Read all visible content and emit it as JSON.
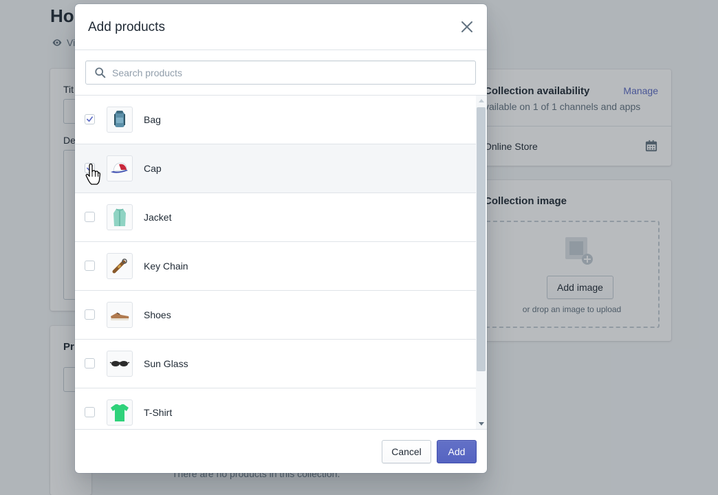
{
  "background": {
    "page_title": "Ho",
    "view_link": "Vi",
    "title_label": "Tit",
    "description_label": "De",
    "products_heading": "Pr",
    "empty_text": "There are no products in this collection.",
    "availability": {
      "title": "Collection availability",
      "manage": "Manage",
      "subtitle": "vailable on 1 of 1 channels and apps",
      "channel": "Online Store",
      "calendar_icon": "calendar-icon"
    },
    "image": {
      "title": "Collection image",
      "add_button": "Add image",
      "drop_text": "or drop an image to upload",
      "placeholder_icon": "image-placeholder-icon"
    }
  },
  "modal": {
    "title": "Add products",
    "close_icon": "close-icon",
    "search": {
      "placeholder": "Search products",
      "value": "",
      "icon": "search-icon"
    },
    "products": [
      {
        "name": "Bag",
        "checked": true
      },
      {
        "name": "Cap",
        "checked": true
      },
      {
        "name": "Jacket",
        "checked": false
      },
      {
        "name": "Key Chain",
        "checked": false
      },
      {
        "name": "Shoes",
        "checked": false
      },
      {
        "name": "Sun Glass",
        "checked": false
      },
      {
        "name": "T-Shirt",
        "checked": false
      }
    ],
    "footer": {
      "cancel": "Cancel",
      "add": "Add"
    }
  },
  "colors": {
    "primary": "#5c6ac4",
    "text": "#212b36",
    "subdued": "#637381",
    "border": "#dfe3e8"
  }
}
